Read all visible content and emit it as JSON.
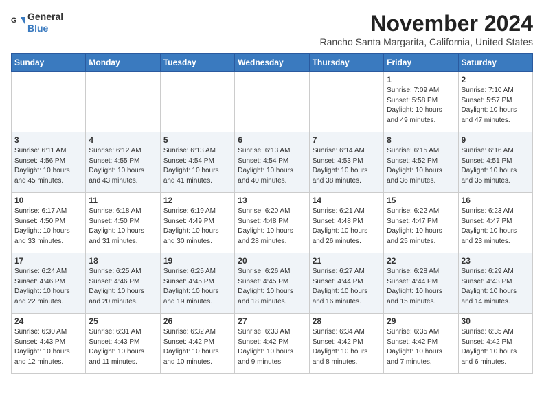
{
  "header": {
    "logo_general": "General",
    "logo_blue": "Blue",
    "title": "November 2024",
    "subtitle": "Rancho Santa Margarita, California, United States"
  },
  "weekdays": [
    "Sunday",
    "Monday",
    "Tuesday",
    "Wednesday",
    "Thursday",
    "Friday",
    "Saturday"
  ],
  "weeks": [
    [
      {
        "day": "",
        "info": ""
      },
      {
        "day": "",
        "info": ""
      },
      {
        "day": "",
        "info": ""
      },
      {
        "day": "",
        "info": ""
      },
      {
        "day": "",
        "info": ""
      },
      {
        "day": "1",
        "info": "Sunrise: 7:09 AM\nSunset: 5:58 PM\nDaylight: 10 hours\nand 49 minutes."
      },
      {
        "day": "2",
        "info": "Sunrise: 7:10 AM\nSunset: 5:57 PM\nDaylight: 10 hours\nand 47 minutes."
      }
    ],
    [
      {
        "day": "3",
        "info": "Sunrise: 6:11 AM\nSunset: 4:56 PM\nDaylight: 10 hours\nand 45 minutes."
      },
      {
        "day": "4",
        "info": "Sunrise: 6:12 AM\nSunset: 4:55 PM\nDaylight: 10 hours\nand 43 minutes."
      },
      {
        "day": "5",
        "info": "Sunrise: 6:13 AM\nSunset: 4:54 PM\nDaylight: 10 hours\nand 41 minutes."
      },
      {
        "day": "6",
        "info": "Sunrise: 6:13 AM\nSunset: 4:54 PM\nDaylight: 10 hours\nand 40 minutes."
      },
      {
        "day": "7",
        "info": "Sunrise: 6:14 AM\nSunset: 4:53 PM\nDaylight: 10 hours\nand 38 minutes."
      },
      {
        "day": "8",
        "info": "Sunrise: 6:15 AM\nSunset: 4:52 PM\nDaylight: 10 hours\nand 36 minutes."
      },
      {
        "day": "9",
        "info": "Sunrise: 6:16 AM\nSunset: 4:51 PM\nDaylight: 10 hours\nand 35 minutes."
      }
    ],
    [
      {
        "day": "10",
        "info": "Sunrise: 6:17 AM\nSunset: 4:50 PM\nDaylight: 10 hours\nand 33 minutes."
      },
      {
        "day": "11",
        "info": "Sunrise: 6:18 AM\nSunset: 4:50 PM\nDaylight: 10 hours\nand 31 minutes."
      },
      {
        "day": "12",
        "info": "Sunrise: 6:19 AM\nSunset: 4:49 PM\nDaylight: 10 hours\nand 30 minutes."
      },
      {
        "day": "13",
        "info": "Sunrise: 6:20 AM\nSunset: 4:48 PM\nDaylight: 10 hours\nand 28 minutes."
      },
      {
        "day": "14",
        "info": "Sunrise: 6:21 AM\nSunset: 4:48 PM\nDaylight: 10 hours\nand 26 minutes."
      },
      {
        "day": "15",
        "info": "Sunrise: 6:22 AM\nSunset: 4:47 PM\nDaylight: 10 hours\nand 25 minutes."
      },
      {
        "day": "16",
        "info": "Sunrise: 6:23 AM\nSunset: 4:47 PM\nDaylight: 10 hours\nand 23 minutes."
      }
    ],
    [
      {
        "day": "17",
        "info": "Sunrise: 6:24 AM\nSunset: 4:46 PM\nDaylight: 10 hours\nand 22 minutes."
      },
      {
        "day": "18",
        "info": "Sunrise: 6:25 AM\nSunset: 4:46 PM\nDaylight: 10 hours\nand 20 minutes."
      },
      {
        "day": "19",
        "info": "Sunrise: 6:25 AM\nSunset: 4:45 PM\nDaylight: 10 hours\nand 19 minutes."
      },
      {
        "day": "20",
        "info": "Sunrise: 6:26 AM\nSunset: 4:45 PM\nDaylight: 10 hours\nand 18 minutes."
      },
      {
        "day": "21",
        "info": "Sunrise: 6:27 AM\nSunset: 4:44 PM\nDaylight: 10 hours\nand 16 minutes."
      },
      {
        "day": "22",
        "info": "Sunrise: 6:28 AM\nSunset: 4:44 PM\nDaylight: 10 hours\nand 15 minutes."
      },
      {
        "day": "23",
        "info": "Sunrise: 6:29 AM\nSunset: 4:43 PM\nDaylight: 10 hours\nand 14 minutes."
      }
    ],
    [
      {
        "day": "24",
        "info": "Sunrise: 6:30 AM\nSunset: 4:43 PM\nDaylight: 10 hours\nand 12 minutes."
      },
      {
        "day": "25",
        "info": "Sunrise: 6:31 AM\nSunset: 4:43 PM\nDaylight: 10 hours\nand 11 minutes."
      },
      {
        "day": "26",
        "info": "Sunrise: 6:32 AM\nSunset: 4:42 PM\nDaylight: 10 hours\nand 10 minutes."
      },
      {
        "day": "27",
        "info": "Sunrise: 6:33 AM\nSunset: 4:42 PM\nDaylight: 10 hours\nand 9 minutes."
      },
      {
        "day": "28",
        "info": "Sunrise: 6:34 AM\nSunset: 4:42 PM\nDaylight: 10 hours\nand 8 minutes."
      },
      {
        "day": "29",
        "info": "Sunrise: 6:35 AM\nSunset: 4:42 PM\nDaylight: 10 hours\nand 7 minutes."
      },
      {
        "day": "30",
        "info": "Sunrise: 6:35 AM\nSunset: 4:42 PM\nDaylight: 10 hours\nand 6 minutes."
      }
    ]
  ]
}
